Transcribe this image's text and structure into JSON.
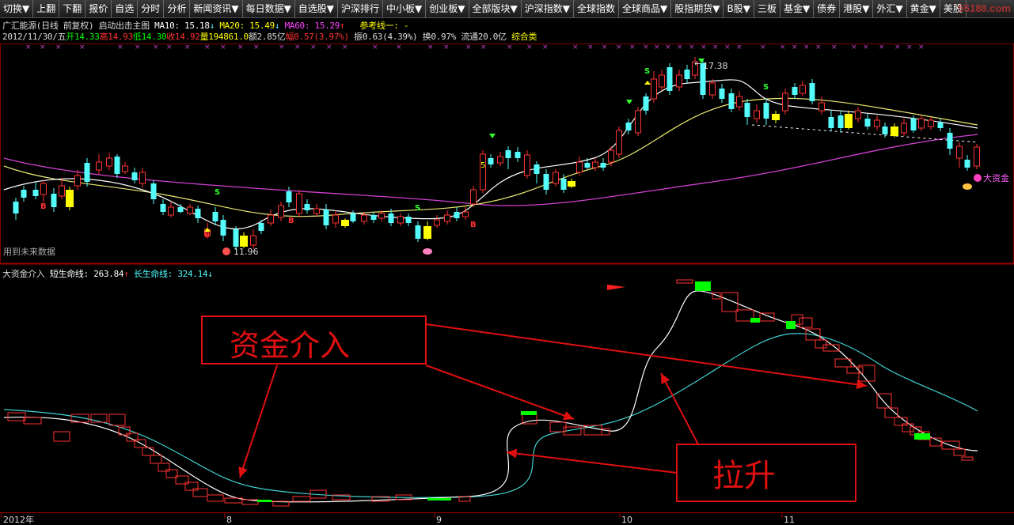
{
  "menu": [
    "切换▼",
    "上翻",
    "下翻",
    "报价",
    "自选",
    "分时",
    "分析",
    "新闻资讯▼",
    "每日数据▼",
    "自选股▼",
    "沪深排行",
    "中小板▼",
    "创业板▼",
    "全部版块▼",
    "沪深指数▼",
    "全球指数",
    "全球商品▼",
    "股指期货▼",
    "B股▼",
    "三板",
    "基金▼",
    "债券",
    "港股▼",
    "外汇▼",
    "黄金▼",
    "美股"
  ],
  "watermark": "55188.com",
  "stock": {
    "title": "广汇能源(日线 前复权) 启动出击主图",
    "ma10": "MA10: 15.18",
    "ma20": "MA20: 15.49",
    "ma60": "MA60: 15.29",
    "ref_line": "参考线一: -",
    "date": "2012/11/30/五",
    "open": "开14.33",
    "high": "高14.93",
    "low": "低14.30",
    "close": "收14.92",
    "volume": "量194861.0",
    "amount": "额2.85亿",
    "change": "幅0.57(3.97%)",
    "amplitude": "振0.63(4.39%)",
    "turnover": "换0.97%",
    "float_cap": "流通20.0亿",
    "category": "综合类"
  },
  "main_chart": {
    "max_label": "17.38",
    "min_label": "11.96",
    "future_note": "用到未来数据",
    "big_money_tag": "大资金",
    "signal_b": "B",
    "signal_s": "S",
    "signal_5": "5"
  },
  "indicator": {
    "name": "大资金介入",
    "short_line": "短生命线: 263.84",
    "long_line": "长生命线: 324.14"
  },
  "annotations": {
    "box1_text": "资金介入",
    "box2_text": "拉升"
  },
  "xaxis": [
    "2012年",
    "8",
    "9",
    "10",
    "11"
  ],
  "colors": {
    "up": "#ff3232",
    "down": "#54fcfc",
    "yellow_block": "#ffff00",
    "green_block": "#00ff00",
    "ma_white": "#ffffff",
    "ma_yellow": "#e8e870",
    "ma_magenta": "#d040d0",
    "annot_red": "#e01010"
  }
}
